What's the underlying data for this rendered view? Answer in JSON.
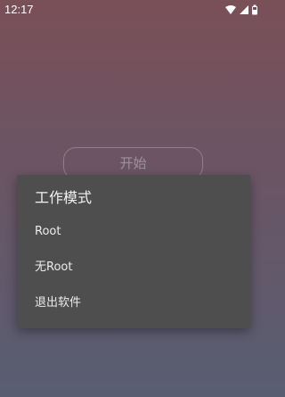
{
  "status_bar": {
    "time": "12:17",
    "icons": [
      "wifi-icon",
      "cellular-signal-icon",
      "battery-icon"
    ]
  },
  "main": {
    "start_button_label": "开始"
  },
  "dialog": {
    "title": "工作模式",
    "items": [
      {
        "label": "Root"
      },
      {
        "label": "无Root"
      },
      {
        "label": "退出软件"
      }
    ]
  },
  "colors": {
    "background_top": "#7a5058",
    "background_bottom": "#585e72",
    "dialog_background": "#4e4e4e",
    "dialog_text": "#ececec"
  }
}
